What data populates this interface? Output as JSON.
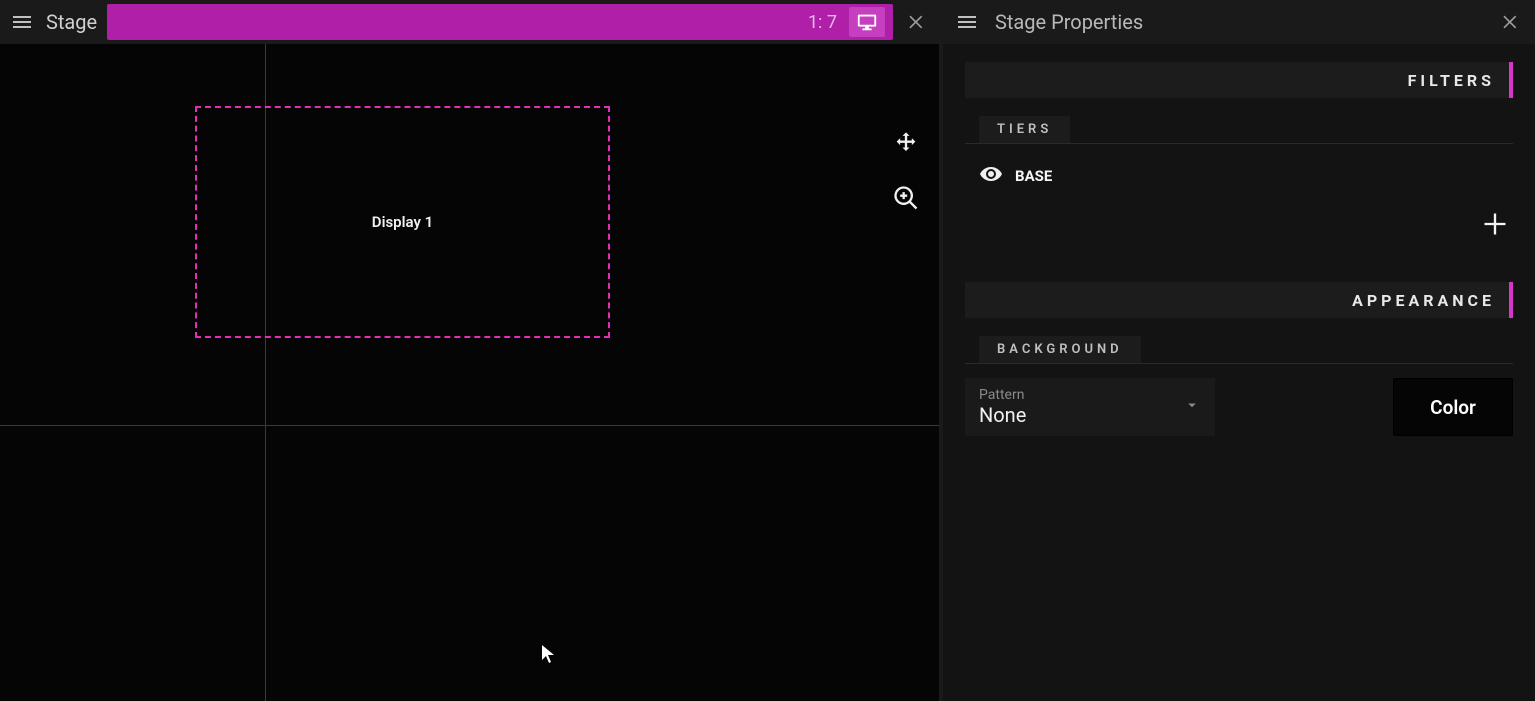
{
  "left": {
    "title": "Stage",
    "ratio": "1: 7",
    "display_label": "Display 1"
  },
  "right": {
    "title": "Stage Properties",
    "sections": {
      "filters": "FILTERS",
      "appearance": "APPEARANCE"
    },
    "tiers_tab": "TIERS",
    "tier_item": "BASE",
    "background_tab": "BACKGROUND",
    "pattern_label": "Pattern",
    "pattern_value": "None",
    "color_button": "Color"
  }
}
